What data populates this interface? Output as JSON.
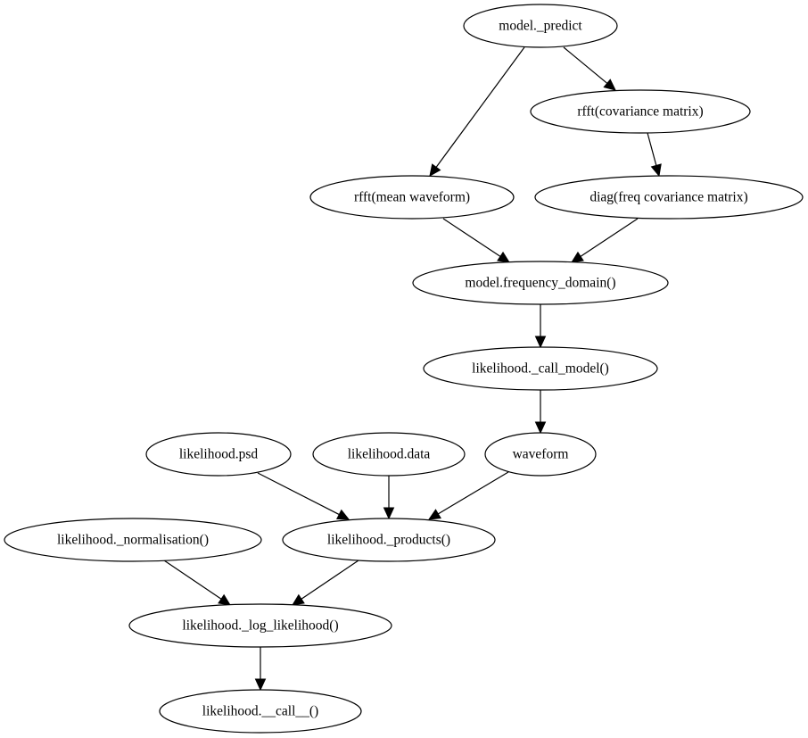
{
  "diagram": {
    "type": "directed-graph",
    "colors": {
      "stroke": "#000000",
      "background": "#ffffff",
      "text": "#000000"
    },
    "nodes": [
      {
        "id": "model_predict",
        "label": "model._predict"
      },
      {
        "id": "rfft_cov",
        "label": "rfft(covariance matrix)"
      },
      {
        "id": "rfft_mean",
        "label": "rfft(mean waveform)"
      },
      {
        "id": "diag_freq_cov",
        "label": "diag(freq covariance matrix)"
      },
      {
        "id": "model_freq_domain",
        "label": "model.frequency_domain()"
      },
      {
        "id": "likelihood_call_model",
        "label": "likelihood._call_model()"
      },
      {
        "id": "likelihood_psd",
        "label": "likelihood.psd"
      },
      {
        "id": "likelihood_data",
        "label": "likelihood.data"
      },
      {
        "id": "waveform",
        "label": "waveform"
      },
      {
        "id": "likelihood_normalisation",
        "label": "likelihood._normalisation()"
      },
      {
        "id": "likelihood_products",
        "label": "likelihood._products()"
      },
      {
        "id": "likelihood_log_likelihood",
        "label": "likelihood._log_likelihood()"
      },
      {
        "id": "likelihood_call",
        "label": "likelihood.__call__()"
      }
    ],
    "edges": [
      {
        "from": "model_predict",
        "to": "rfft_mean"
      },
      {
        "from": "model_predict",
        "to": "rfft_cov"
      },
      {
        "from": "rfft_cov",
        "to": "diag_freq_cov"
      },
      {
        "from": "rfft_mean",
        "to": "model_freq_domain"
      },
      {
        "from": "diag_freq_cov",
        "to": "model_freq_domain"
      },
      {
        "from": "model_freq_domain",
        "to": "likelihood_call_model"
      },
      {
        "from": "likelihood_call_model",
        "to": "waveform"
      },
      {
        "from": "likelihood_psd",
        "to": "likelihood_products"
      },
      {
        "from": "likelihood_data",
        "to": "likelihood_products"
      },
      {
        "from": "waveform",
        "to": "likelihood_products"
      },
      {
        "from": "likelihood_normalisation",
        "to": "likelihood_log_likelihood"
      },
      {
        "from": "likelihood_products",
        "to": "likelihood_log_likelihood"
      },
      {
        "from": "likelihood_log_likelihood",
        "to": "likelihood_call"
      }
    ]
  }
}
